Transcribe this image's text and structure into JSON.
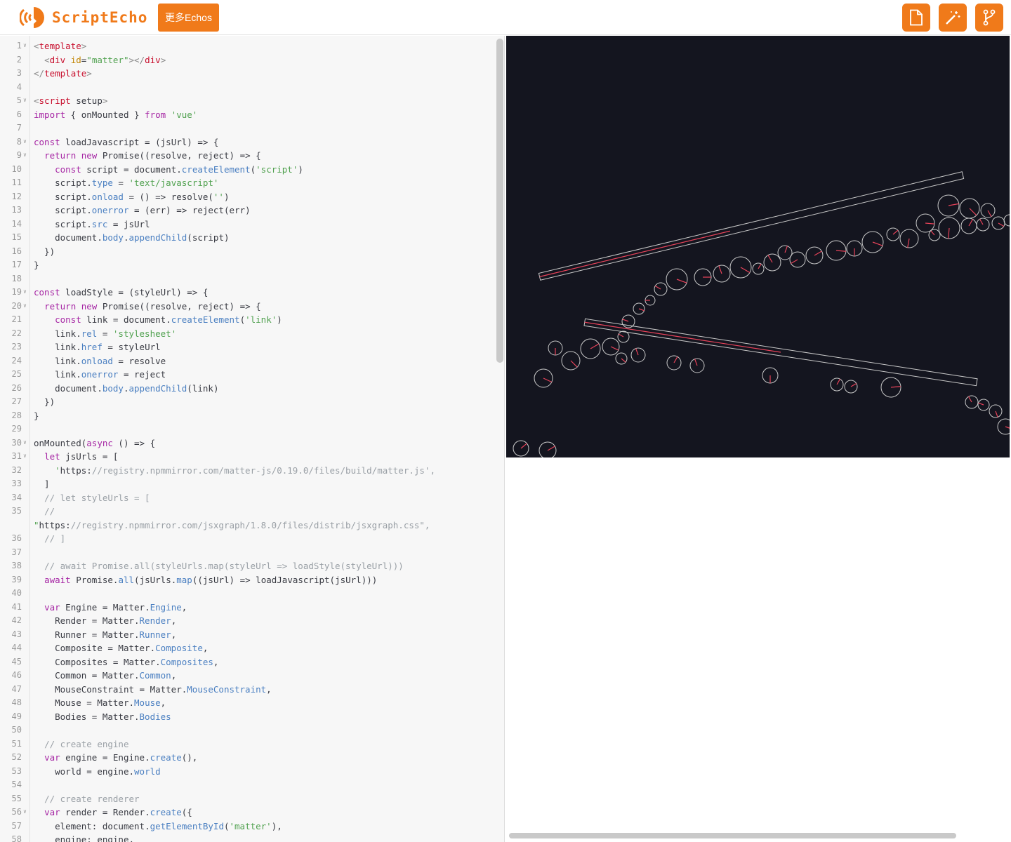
{
  "header": {
    "logo_text": "ScriptEcho",
    "more_button": "更多Echos",
    "accent_color": "#f07a1a",
    "tools": [
      {
        "icon": "file-icon",
        "name": "new-file-button"
      },
      {
        "icon": "magic-wand-icon",
        "name": "magic-button"
      },
      {
        "icon": "git-fork-icon",
        "name": "fork-button"
      }
    ]
  },
  "editor": {
    "lines": [
      {
        "n": "1",
        "fold": true,
        "text": "<template>"
      },
      {
        "n": "2",
        "fold": false,
        "text": "  <div id=\"matter\"></div>"
      },
      {
        "n": "3",
        "fold": false,
        "text": "</template>"
      },
      {
        "n": "4",
        "fold": false,
        "text": ""
      },
      {
        "n": "5",
        "fold": true,
        "text": "<script setup>"
      },
      {
        "n": "6",
        "fold": false,
        "text": "import { onMounted } from 'vue'"
      },
      {
        "n": "7",
        "fold": false,
        "text": ""
      },
      {
        "n": "8",
        "fold": true,
        "text": "const loadJavascript = (jsUrl) => {"
      },
      {
        "n": "9",
        "fold": true,
        "text": "  return new Promise((resolve, reject) => {"
      },
      {
        "n": "10",
        "fold": false,
        "text": "    const script = document.createElement('script')"
      },
      {
        "n": "11",
        "fold": false,
        "text": "    script.type = 'text/javascript'"
      },
      {
        "n": "12",
        "fold": false,
        "text": "    script.onload = () => resolve('')"
      },
      {
        "n": "13",
        "fold": false,
        "text": "    script.onerror = (err) => reject(err)"
      },
      {
        "n": "14",
        "fold": false,
        "text": "    script.src = jsUrl"
      },
      {
        "n": "15",
        "fold": false,
        "text": "    document.body.appendChild(script)"
      },
      {
        "n": "16",
        "fold": false,
        "text": "  })"
      },
      {
        "n": "17",
        "fold": false,
        "text": "}"
      },
      {
        "n": "18",
        "fold": false,
        "text": ""
      },
      {
        "n": "19",
        "fold": true,
        "text": "const loadStyle = (styleUrl) => {"
      },
      {
        "n": "20",
        "fold": true,
        "text": "  return new Promise((resolve, reject) => {"
      },
      {
        "n": "21",
        "fold": false,
        "text": "    const link = document.createElement('link')"
      },
      {
        "n": "22",
        "fold": false,
        "text": "    link.rel = 'stylesheet'"
      },
      {
        "n": "23",
        "fold": false,
        "text": "    link.href = styleUrl"
      },
      {
        "n": "24",
        "fold": false,
        "text": "    link.onload = resolve"
      },
      {
        "n": "25",
        "fold": false,
        "text": "    link.onerror = reject"
      },
      {
        "n": "26",
        "fold": false,
        "text": "    document.body.appendChild(link)"
      },
      {
        "n": "27",
        "fold": false,
        "text": "  })"
      },
      {
        "n": "28",
        "fold": false,
        "text": "}"
      },
      {
        "n": "29",
        "fold": false,
        "text": ""
      },
      {
        "n": "30",
        "fold": true,
        "text": "onMounted(async () => {"
      },
      {
        "n": "31",
        "fold": true,
        "text": "  let jsUrls = ["
      },
      {
        "n": "32",
        "fold": false,
        "text": "    'https://registry.npmmirror.com/matter-js/0.19.0/files/build/matter.js',"
      },
      {
        "n": "33",
        "fold": false,
        "text": "  ]"
      },
      {
        "n": "34",
        "fold": false,
        "text": "  // let styleUrls = ["
      },
      {
        "n": "35",
        "fold": false,
        "text": "  //"
      },
      {
        "n": "",
        "fold": false,
        "text": "\"https://registry.npmmirror.com/jsxgraph/1.8.0/files/distrib/jsxgraph.css\","
      },
      {
        "n": "36",
        "fold": false,
        "text": "  // ]"
      },
      {
        "n": "37",
        "fold": false,
        "text": ""
      },
      {
        "n": "38",
        "fold": false,
        "text": "  // await Promise.all(styleUrls.map(styleUrl => loadStyle(styleUrl)))"
      },
      {
        "n": "39",
        "fold": false,
        "text": "  await Promise.all(jsUrls.map((jsUrl) => loadJavascript(jsUrl)))"
      },
      {
        "n": "40",
        "fold": false,
        "text": ""
      },
      {
        "n": "41",
        "fold": false,
        "text": "  var Engine = Matter.Engine,"
      },
      {
        "n": "42",
        "fold": false,
        "text": "    Render = Matter.Render,"
      },
      {
        "n": "43",
        "fold": false,
        "text": "    Runner = Matter.Runner,"
      },
      {
        "n": "44",
        "fold": false,
        "text": "    Composite = Matter.Composite,"
      },
      {
        "n": "45",
        "fold": false,
        "text": "    Composites = Matter.Composites,"
      },
      {
        "n": "46",
        "fold": false,
        "text": "    Common = Matter.Common,"
      },
      {
        "n": "47",
        "fold": false,
        "text": "    MouseConstraint = Matter.MouseConstraint,"
      },
      {
        "n": "48",
        "fold": false,
        "text": "    Mouse = Matter.Mouse,"
      },
      {
        "n": "49",
        "fold": false,
        "text": "    Bodies = Matter.Bodies"
      },
      {
        "n": "50",
        "fold": false,
        "text": ""
      },
      {
        "n": "51",
        "fold": false,
        "text": "  // create engine"
      },
      {
        "n": "52",
        "fold": false,
        "text": "  var engine = Engine.create(),"
      },
      {
        "n": "53",
        "fold": false,
        "text": "    world = engine.world"
      },
      {
        "n": "54",
        "fold": false,
        "text": ""
      },
      {
        "n": "55",
        "fold": false,
        "text": "  // create renderer"
      },
      {
        "n": "56",
        "fold": true,
        "text": "  var render = Render.create({"
      },
      {
        "n": "57",
        "fold": false,
        "text": "    element: document.getElementById('matter'),"
      },
      {
        "n": "58",
        "fold": false,
        "text": "    engine: engine,"
      }
    ]
  },
  "preview": {
    "background": "#14151f",
    "outline_color": "#c9c9c9",
    "angle_color": "#e8435a"
  }
}
